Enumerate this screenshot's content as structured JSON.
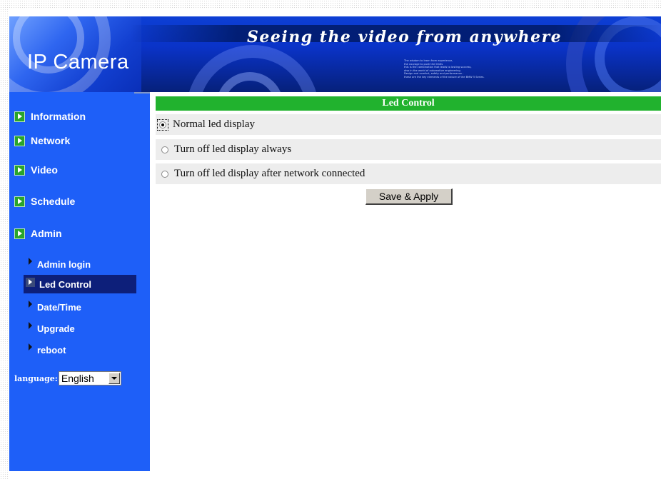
{
  "banner": {
    "logo_text": "IP Camera",
    "slogan": "Seeing the video from anywhere",
    "fine_print": [
      "The wisdom to learn from experience,",
      "the courage to push the limits",
      "this is the combination that leads to lasting success,",
      "also in the world of automotive engineering.",
      "Design and comfort, safety and performance -",
      "these are the key elements of the nature of the BMW 5 Series."
    ]
  },
  "sidebar": {
    "nav": [
      {
        "label": "Information"
      },
      {
        "label": "Network"
      },
      {
        "label": "Video"
      },
      {
        "label": "Schedule"
      },
      {
        "label": "Admin"
      }
    ],
    "admin_sub": [
      {
        "label": "Admin login",
        "active": false
      },
      {
        "label": "Led Control",
        "active": true
      },
      {
        "label": "Date/Time",
        "active": false
      },
      {
        "label": "Upgrade",
        "active": false
      },
      {
        "label": "reboot",
        "active": false
      }
    ],
    "language_label": "language:",
    "language_value": "English"
  },
  "main": {
    "panel_title": "Led Control",
    "options": [
      {
        "label": "Normal led display",
        "checked": true
      },
      {
        "label": "Turn off led display always",
        "checked": false
      },
      {
        "label": "Turn off led display after network connected",
        "checked": false
      }
    ],
    "save_label": "Save & Apply"
  },
  "colors": {
    "sidebar_bg": "#1e5ff8",
    "header_green": "#21b22e",
    "active_item_bg": "#0d1f7a"
  }
}
